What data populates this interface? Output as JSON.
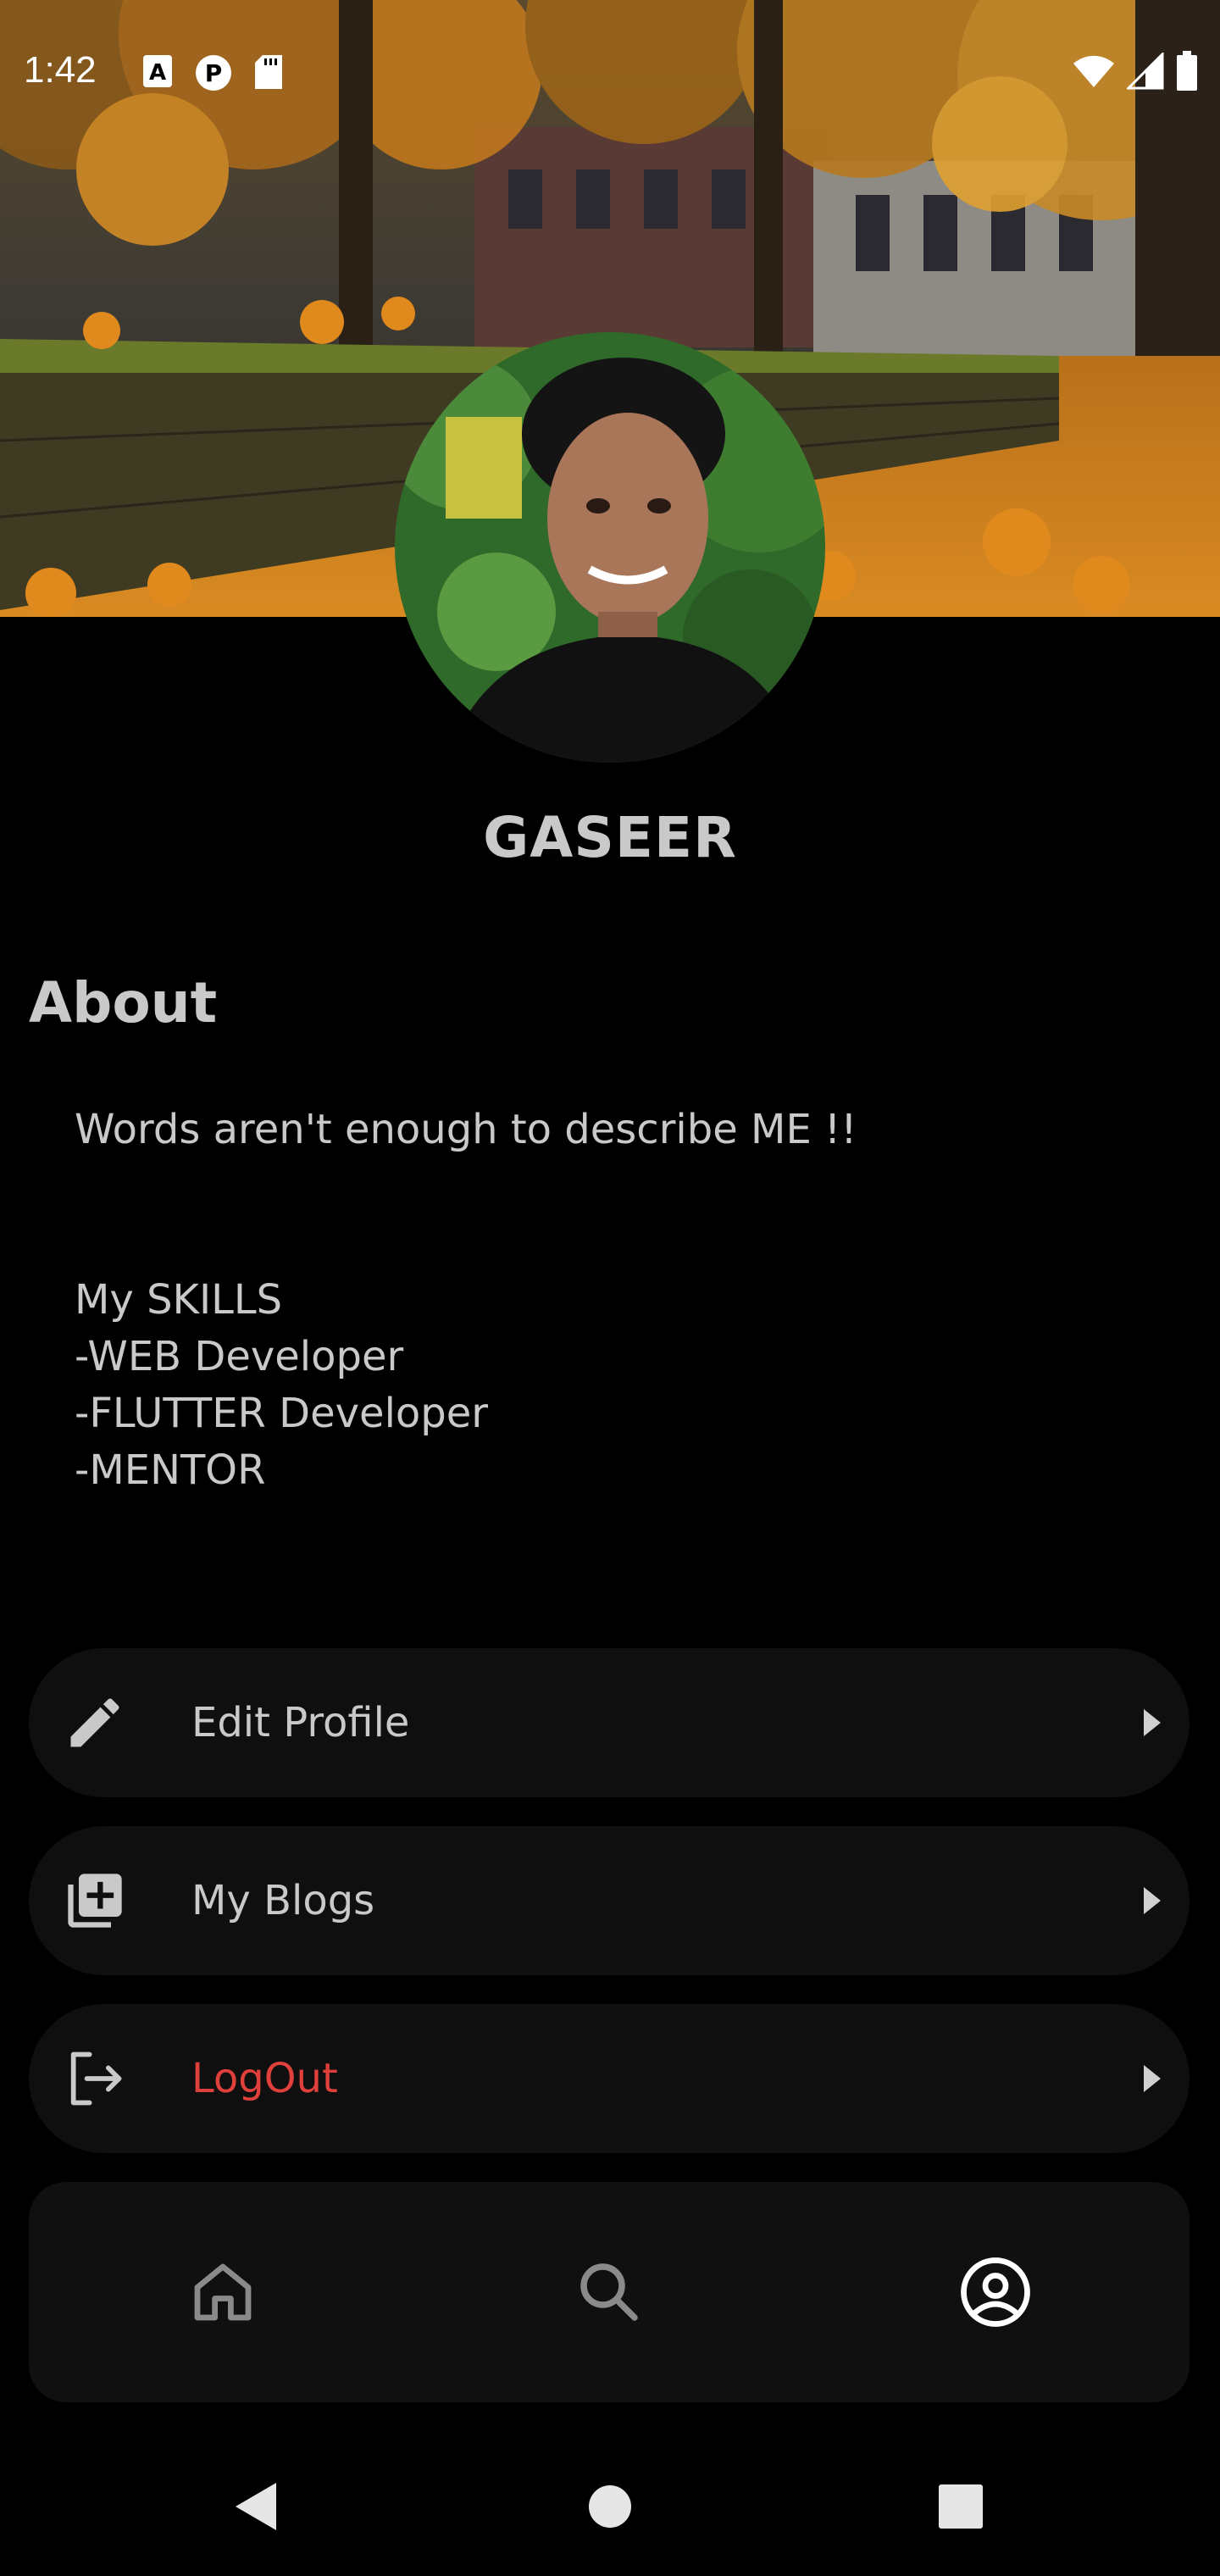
{
  "status_bar": {
    "time": "1:42",
    "left_icons": [
      "text-a-icon",
      "p-circle-icon",
      "sd-card-icon"
    ],
    "right_icons": [
      "wifi-icon",
      "cell-signal-icon",
      "battery-icon"
    ]
  },
  "profile": {
    "name": "GASEER"
  },
  "about": {
    "heading": "About",
    "text": "Words aren't enough to describe ME !!\n\n\nMy SKILLS\n-WEB Developer\n-FLUTTER Developer\n-MENTOR"
  },
  "menu": [
    {
      "label": "Edit Profile",
      "icon": "pencil-icon"
    },
    {
      "label": "My Blogs",
      "icon": "library-add-icon"
    },
    {
      "label": "LogOut",
      "icon": "logout-icon",
      "color": "#e0403b"
    }
  ],
  "bottom_nav": {
    "items": [
      {
        "icon": "home-icon",
        "active": false
      },
      {
        "icon": "search-icon",
        "active": false
      },
      {
        "icon": "account-circle-icon",
        "active": true
      }
    ]
  },
  "system_nav": {
    "items": [
      "back-icon",
      "home-circle-icon",
      "recents-square-icon"
    ]
  },
  "colors": {
    "background": "#000000",
    "card": "#0f0f0f",
    "text": "#c9c9c9",
    "danger": "#e0403b",
    "icon_inactive": "#8a8a8a",
    "icon_active": "#ffffff"
  }
}
